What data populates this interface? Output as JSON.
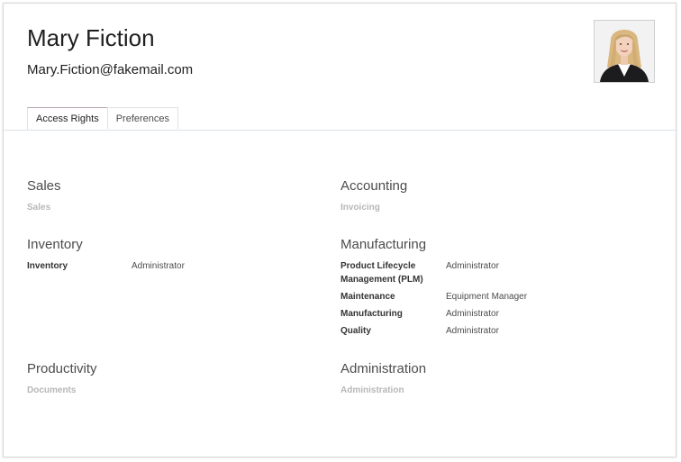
{
  "user": {
    "name": "Mary Fiction",
    "email": "Mary.Fiction@fakemail.com"
  },
  "tabs": [
    {
      "label": "Access Rights",
      "active": true
    },
    {
      "label": "Preferences",
      "active": false
    }
  ],
  "groups": {
    "sales": {
      "title": "Sales",
      "note": "Sales"
    },
    "accounting": {
      "title": "Accounting",
      "note": "Invoicing"
    },
    "inventory": {
      "title": "Inventory",
      "rows": [
        {
          "label": "Inventory",
          "value": "Administrator"
        }
      ]
    },
    "manufacturing": {
      "title": "Manufacturing",
      "rows": [
        {
          "label_line1": "Product Lifecycle",
          "label_line2": "Management (PLM)",
          "value": "Administrator"
        },
        {
          "label": "Maintenance",
          "value": "Equipment Manager"
        },
        {
          "label": "Manufacturing",
          "value": "Administrator"
        },
        {
          "label": "Quality",
          "value": "Administrator"
        }
      ]
    },
    "productivity": {
      "title": "Productivity",
      "note": "Documents"
    },
    "administration": {
      "title": "Administration",
      "note": "Administration"
    }
  },
  "icons": {
    "avatar": "user-photo"
  },
  "colors": {
    "active_tab_border": "#b9a2b0",
    "muted_text": "#b7b7b7"
  }
}
